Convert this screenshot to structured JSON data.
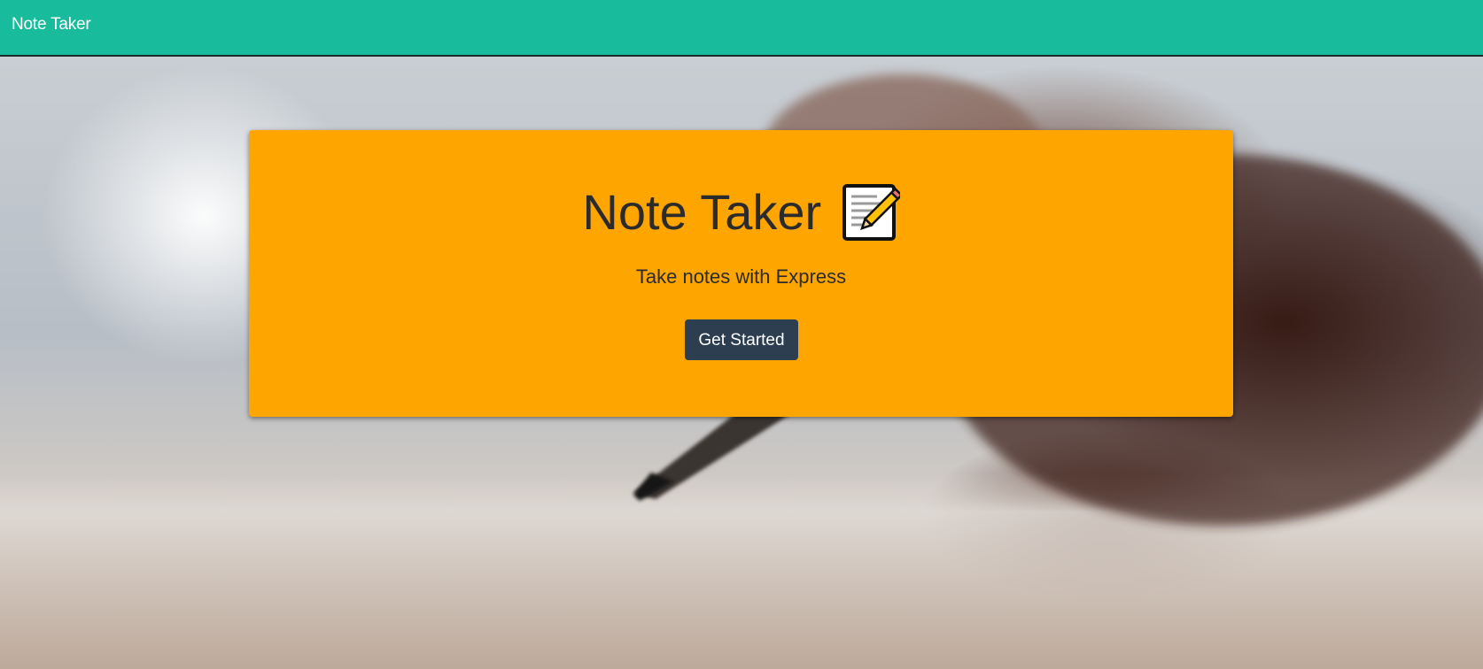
{
  "navbar": {
    "brand": "Note Taker",
    "background_color": "#18bc9c"
  },
  "hero": {
    "background_description": "blurred hand holding pencil over paper",
    "jumbotron": {
      "title": "Note Taker",
      "title_icon": "memo-icon",
      "subtitle": "Take notes with Express",
      "button_label": "Get Started",
      "background_color": "#ffa500",
      "button_color": "#2c3e50"
    }
  }
}
